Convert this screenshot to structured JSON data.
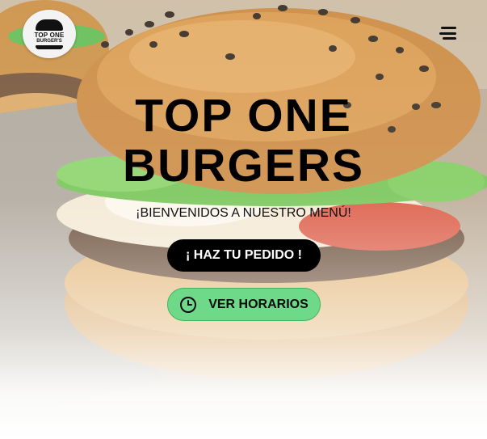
{
  "brand": {
    "logo_line1": "TOP ONE",
    "logo_line2": "BURGER'S"
  },
  "header": {
    "menu_icon": "hamburger-menu-icon"
  },
  "hero": {
    "title_line1": "TOP ONE",
    "title_line2": "BURGERS",
    "subtitle": "¡BIENVENIDOS A NUESTRO MENÚ!",
    "order_button": "¡ HAZ TU PEDIDO !",
    "hours_button": "VER HORARIOS",
    "hours_icon": "clock-icon",
    "background": "burger-photo"
  },
  "colors": {
    "order_button_bg": "#000000",
    "hours_button_bg": "#6fd98a",
    "hours_button_border": "#43b561"
  }
}
